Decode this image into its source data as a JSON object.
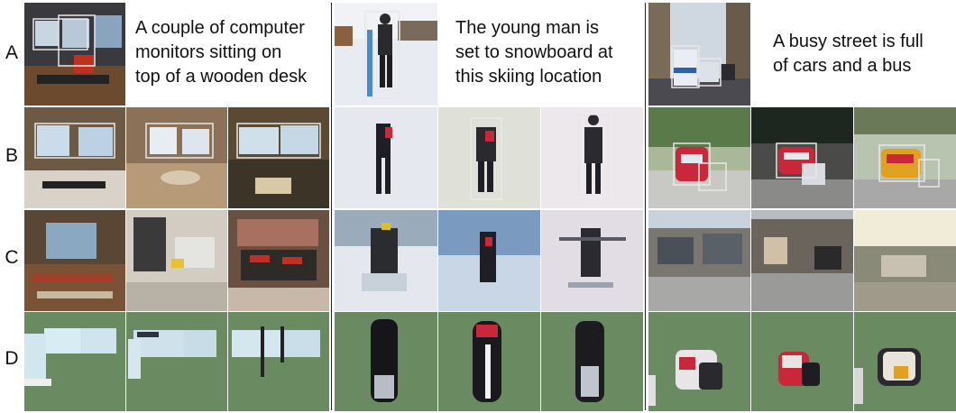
{
  "row_labels": [
    "A",
    "B",
    "C",
    "D"
  ],
  "captions": [
    {
      "lines": [
        "A couple of computer",
        "monitors sitting on",
        "top of a wooden desk"
      ]
    },
    {
      "lines": [
        "The young man is",
        "set to snowboard at",
        "this skiing location"
      ]
    },
    {
      "lines": [
        "A busy street is full",
        "of cars and a bus"
      ]
    }
  ],
  "colors": {
    "layout_background": "#6a8a62",
    "box_stroke": "#e8e8e8",
    "desk_wood": "#7a5a38",
    "snow": "#eef0f5",
    "street_sky": "#cfd8e0",
    "bus_red": "#c8283a"
  },
  "groups": [
    {
      "theme": "desk"
    },
    {
      "theme": "snow"
    },
    {
      "theme": "street"
    }
  ]
}
